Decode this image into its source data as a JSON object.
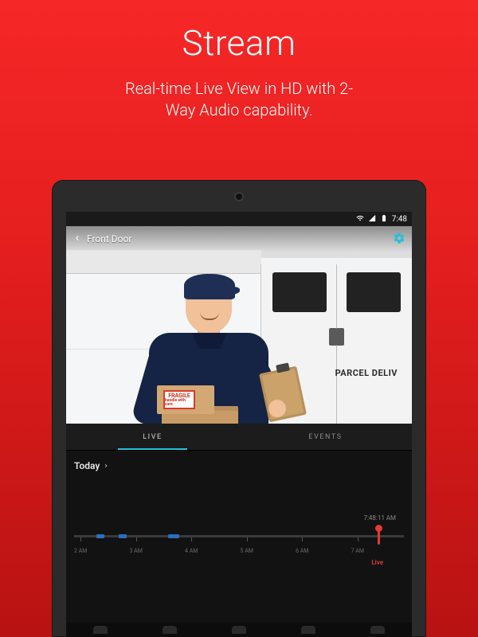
{
  "marketing": {
    "title": "Stream",
    "subtitle_line1": "Real-time Live View in HD with 2-",
    "subtitle_line2": "Way Audio capability."
  },
  "statusbar": {
    "time": "7:48"
  },
  "camera_view": {
    "title": "Front Door",
    "van_text": "PARCEL DELIV",
    "fragile_main": "FRAGILE",
    "fragile_sub": "handle\nwith care"
  },
  "tabs": {
    "live": "LIVE",
    "events": "EVENTS"
  },
  "timeline": {
    "day_label": "Today",
    "timestamp": "7:48:11 AM",
    "live_label": "Live",
    "ticks": [
      "2 AM",
      "3 AM",
      "4 AM",
      "5 AM",
      "6 AM",
      "7 AM"
    ]
  },
  "colors": {
    "accent_red": "#e43a32",
    "accent_teal": "#26c0d9",
    "bg_gradient_top": "#f62727",
    "bg_gradient_bottom": "#b81212"
  }
}
